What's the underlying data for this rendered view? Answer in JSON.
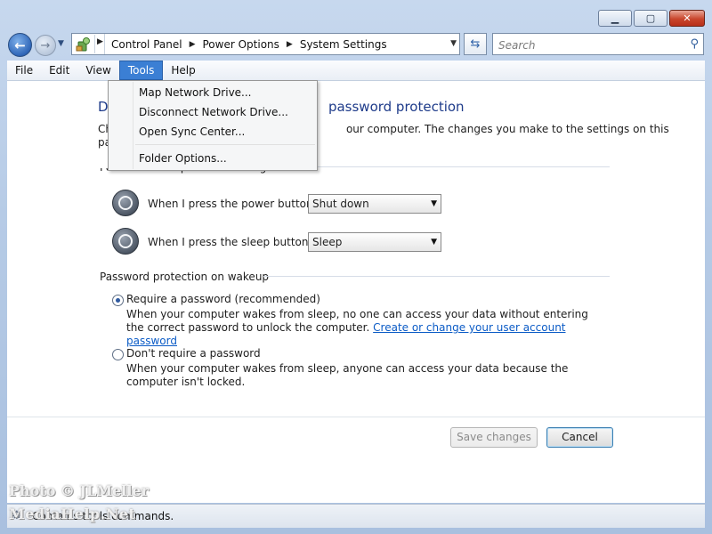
{
  "window": {
    "minimize_glyph": "▁",
    "maximize_glyph": "▢",
    "close_glyph": "✕"
  },
  "navigation": {
    "breadcrumbs": [
      "Control Panel",
      "Power Options",
      "System Settings"
    ],
    "search_placeholder": "Search",
    "address_icon": "control-panel-icon",
    "refresh_icon": "refresh-icon",
    "search_icon": "search-icon"
  },
  "menubar": {
    "items": [
      "File",
      "Edit",
      "View",
      "Tools",
      "Help"
    ],
    "active": "Tools"
  },
  "tools_menu": {
    "items": [
      "Map Network Drive...",
      "Disconnect Network Drive...",
      "Open Sync Center...",
      "Folder Options..."
    ]
  },
  "content": {
    "heading_visible_start": "D",
    "heading_visible_end": "password protection",
    "desc_line1_start": "Ch",
    "desc_line1_end": "our computer. The changes you make to the settings on this",
    "desc_line2_start": "pa",
    "power_section_title_visible": "Power and sleep button settings",
    "power_button_label": "When I press the power button:",
    "power_button_value": "Shut down",
    "sleep_button_label": "When I press the sleep button:",
    "sleep_button_value": "Sleep",
    "password_section_title": "Password protection on wakeup",
    "require_label": "Require a password (recommended)",
    "require_desc": "When your computer wakes from sleep, no one can access your data without entering the correct password to unlock the computer.",
    "require_link": "Create or change your user account password",
    "no_require_label": "Don't require a password",
    "no_require_desc": "When your computer wakes from sleep, anyone can access your data because the computer isn't locked.",
    "require_selected": true
  },
  "buttons": {
    "save": "Save changes",
    "cancel": "Cancel"
  },
  "statusbar": {
    "text": "Contains tools commands."
  },
  "watermark": {
    "line1": "Photo © JLMeller",
    "line2": "MediaHelp.Net"
  },
  "colors": {
    "accent": "#3b7fd4",
    "heading": "#1e3b8a",
    "link": "#0b5bc6"
  }
}
